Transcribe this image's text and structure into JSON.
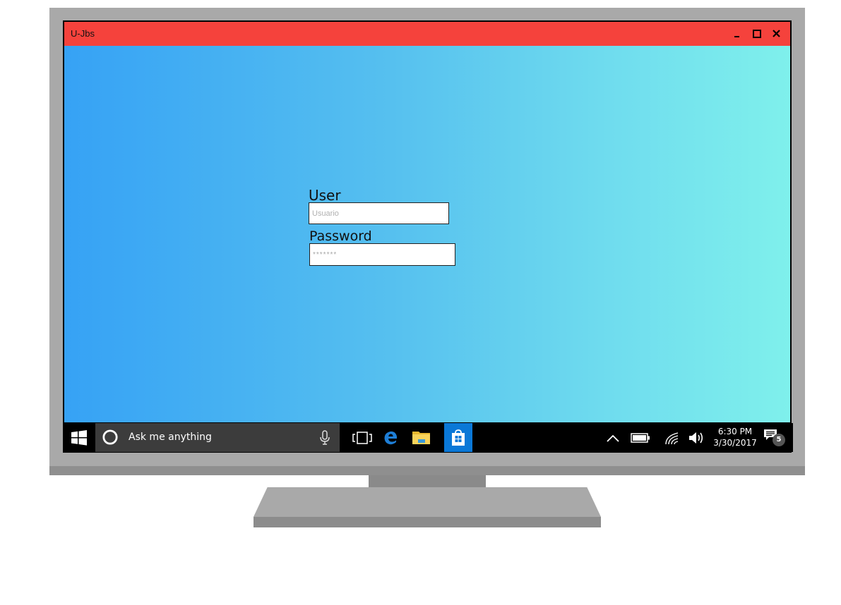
{
  "window": {
    "title": "U-Jbs",
    "controls": {
      "minimize": "minimize-icon",
      "maximize": "maximize-icon",
      "close": "close-icon"
    }
  },
  "login": {
    "user_label": "User",
    "user_placeholder": "Usuario",
    "password_label": "Password",
    "password_placeholder": "*******"
  },
  "taskbar": {
    "search_placeholder": "Ask me anything",
    "clock_time": "6:30 PM",
    "clock_date": "3/30/2017",
    "notification_count": "5",
    "icons": [
      "windows-start-icon",
      "cortana-icon",
      "microphone-icon",
      "task-view-icon",
      "edge-icon",
      "file-explorer-icon",
      "store-icon",
      "chevron-up-icon",
      "battery-icon",
      "wifi-icon",
      "volume-icon",
      "action-center-icon"
    ]
  },
  "colors": {
    "titlebar": "#f5423c",
    "gradient_start": "#36a2f5",
    "gradient_end": "#7ff0ec",
    "taskbar": "#000000",
    "store_highlight": "#0a78d7"
  }
}
